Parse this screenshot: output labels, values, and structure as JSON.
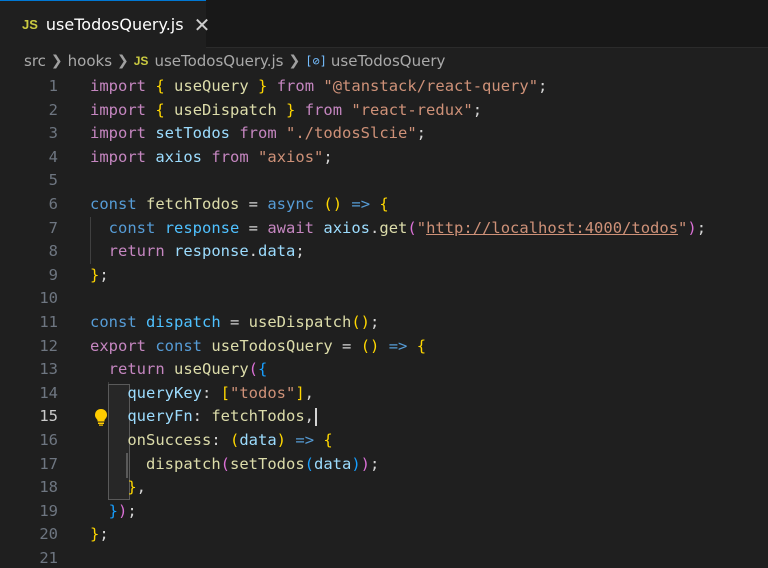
{
  "tab": {
    "badge": "JS",
    "label": "useTodosQuery.js",
    "close": "✕"
  },
  "breadcrumb": {
    "segments": [
      "src",
      "hooks",
      "useTodosQuery.js",
      "useTodosQuery"
    ],
    "file_badge": "JS",
    "symbol_icon": "[⊘]"
  },
  "editor": {
    "active_line": 15,
    "line_numbers": [
      "1",
      "2",
      "3",
      "4",
      "5",
      "6",
      "7",
      "8",
      "9",
      "10",
      "11",
      "12",
      "13",
      "14",
      "15",
      "16",
      "17",
      "18",
      "19",
      "20",
      "21"
    ],
    "lines": [
      [
        [
          "kw",
          "import"
        ],
        [
          "pun",
          " "
        ],
        [
          "br1",
          "{"
        ],
        [
          "pun",
          " "
        ],
        [
          "fn",
          "useQuery"
        ],
        [
          "pun",
          " "
        ],
        [
          "br1",
          "}"
        ],
        [
          "pun",
          " "
        ],
        [
          "kw",
          "from"
        ],
        [
          "pun",
          " "
        ],
        [
          "str",
          "\"@tanstack/react-query\""
        ],
        [
          "pun",
          ";"
        ]
      ],
      [
        [
          "kw",
          "import"
        ],
        [
          "pun",
          " "
        ],
        [
          "br1",
          "{"
        ],
        [
          "pun",
          " "
        ],
        [
          "fn",
          "useDispatch"
        ],
        [
          "pun",
          " "
        ],
        [
          "br1",
          "}"
        ],
        [
          "pun",
          " "
        ],
        [
          "kw",
          "from"
        ],
        [
          "pun",
          " "
        ],
        [
          "str",
          "\"react-redux\""
        ],
        [
          "pun",
          ";"
        ]
      ],
      [
        [
          "kw",
          "import"
        ],
        [
          "pun",
          " "
        ],
        [
          "var",
          "setTodos"
        ],
        [
          "pun",
          " "
        ],
        [
          "kw",
          "from"
        ],
        [
          "pun",
          " "
        ],
        [
          "str",
          "\"./todosSlcie\""
        ],
        [
          "pun",
          ";"
        ]
      ],
      [
        [
          "kw",
          "import"
        ],
        [
          "pun",
          " "
        ],
        [
          "var",
          "axios"
        ],
        [
          "pun",
          " "
        ],
        [
          "kw",
          "from"
        ],
        [
          "pun",
          " "
        ],
        [
          "str",
          "\"axios\""
        ],
        [
          "pun",
          ";"
        ]
      ],
      [],
      [
        [
          "kwb",
          "const"
        ],
        [
          "pun",
          " "
        ],
        [
          "fn",
          "fetchTodos"
        ],
        [
          "pun",
          " = "
        ],
        [
          "kwb",
          "async"
        ],
        [
          "pun",
          " "
        ],
        [
          "br1",
          "()"
        ],
        [
          "pun",
          " "
        ],
        [
          "kwb",
          "=>"
        ],
        [
          "pun",
          " "
        ],
        [
          "br1",
          "{"
        ]
      ],
      [
        [
          "pun",
          "  "
        ],
        [
          "kwb",
          "const"
        ],
        [
          "pun",
          " "
        ],
        [
          "cst",
          "response"
        ],
        [
          "pun",
          " = "
        ],
        [
          "kw",
          "await"
        ],
        [
          "pun",
          " "
        ],
        [
          "var",
          "axios"
        ],
        [
          "pun",
          "."
        ],
        [
          "fn",
          "get"
        ],
        [
          "br2",
          "("
        ],
        [
          "str",
          "\""
        ],
        [
          "url",
          "http://localhost:4000/todos"
        ],
        [
          "str",
          "\""
        ],
        [
          "br2",
          ")"
        ],
        [
          "pun",
          ";"
        ]
      ],
      [
        [
          "pun",
          "  "
        ],
        [
          "kw",
          "return"
        ],
        [
          "pun",
          " "
        ],
        [
          "var",
          "response"
        ],
        [
          "pun",
          "."
        ],
        [
          "var",
          "data"
        ],
        [
          "pun",
          ";"
        ]
      ],
      [
        [
          "br1",
          "}"
        ],
        [
          "pun",
          ";"
        ]
      ],
      [],
      [
        [
          "kwb",
          "const"
        ],
        [
          "pun",
          " "
        ],
        [
          "cst",
          "dispatch"
        ],
        [
          "pun",
          " = "
        ],
        [
          "fn",
          "useDispatch"
        ],
        [
          "br1",
          "()"
        ],
        [
          "pun",
          ";"
        ]
      ],
      [
        [
          "kw",
          "export"
        ],
        [
          "pun",
          " "
        ],
        [
          "kwb",
          "const"
        ],
        [
          "pun",
          " "
        ],
        [
          "fn",
          "useTodosQuery"
        ],
        [
          "pun",
          " = "
        ],
        [
          "br1",
          "()"
        ],
        [
          "pun",
          " "
        ],
        [
          "kwb",
          "=>"
        ],
        [
          "pun",
          " "
        ],
        [
          "br1",
          "{"
        ]
      ],
      [
        [
          "pun",
          "  "
        ],
        [
          "kw",
          "return"
        ],
        [
          "pun",
          " "
        ],
        [
          "fn",
          "useQuery"
        ],
        [
          "br2",
          "("
        ],
        [
          "br3",
          "{"
        ]
      ],
      [
        [
          "pun",
          "    "
        ],
        [
          "var",
          "queryKey"
        ],
        [
          "pun",
          ": "
        ],
        [
          "br1",
          "["
        ],
        [
          "str",
          "\"todos\""
        ],
        [
          "br1",
          "]"
        ],
        [
          "pun",
          ","
        ]
      ],
      [
        [
          "pun",
          "    "
        ],
        [
          "var",
          "queryFn"
        ],
        [
          "pun",
          ": "
        ],
        [
          "fn",
          "fetchTodos"
        ],
        [
          "pun",
          ","
        ]
      ],
      [
        [
          "pun",
          "    "
        ],
        [
          "fn",
          "onSuccess"
        ],
        [
          "pun",
          ": "
        ],
        [
          "br1",
          "("
        ],
        [
          "var",
          "data"
        ],
        [
          "br1",
          ")"
        ],
        [
          "pun",
          " "
        ],
        [
          "kwb",
          "=>"
        ],
        [
          "pun",
          " "
        ],
        [
          "br1",
          "{"
        ]
      ],
      [
        [
          "pun",
          "      "
        ],
        [
          "fn",
          "dispatch"
        ],
        [
          "br2",
          "("
        ],
        [
          "fn",
          "setTodos"
        ],
        [
          "br3",
          "("
        ],
        [
          "var",
          "data"
        ],
        [
          "br3",
          ")"
        ],
        [
          "br2",
          ")"
        ],
        [
          "pun",
          ";"
        ]
      ],
      [
        [
          "pun",
          "    "
        ],
        [
          "br1",
          "}"
        ],
        [
          "pun",
          ","
        ]
      ],
      [
        [
          "pun",
          "  "
        ],
        [
          "br3",
          "}"
        ],
        [
          "br2",
          ")"
        ],
        [
          "pun",
          ";"
        ]
      ],
      [
        [
          "br1",
          "}"
        ],
        [
          "pun",
          ";"
        ]
      ],
      []
    ]
  }
}
